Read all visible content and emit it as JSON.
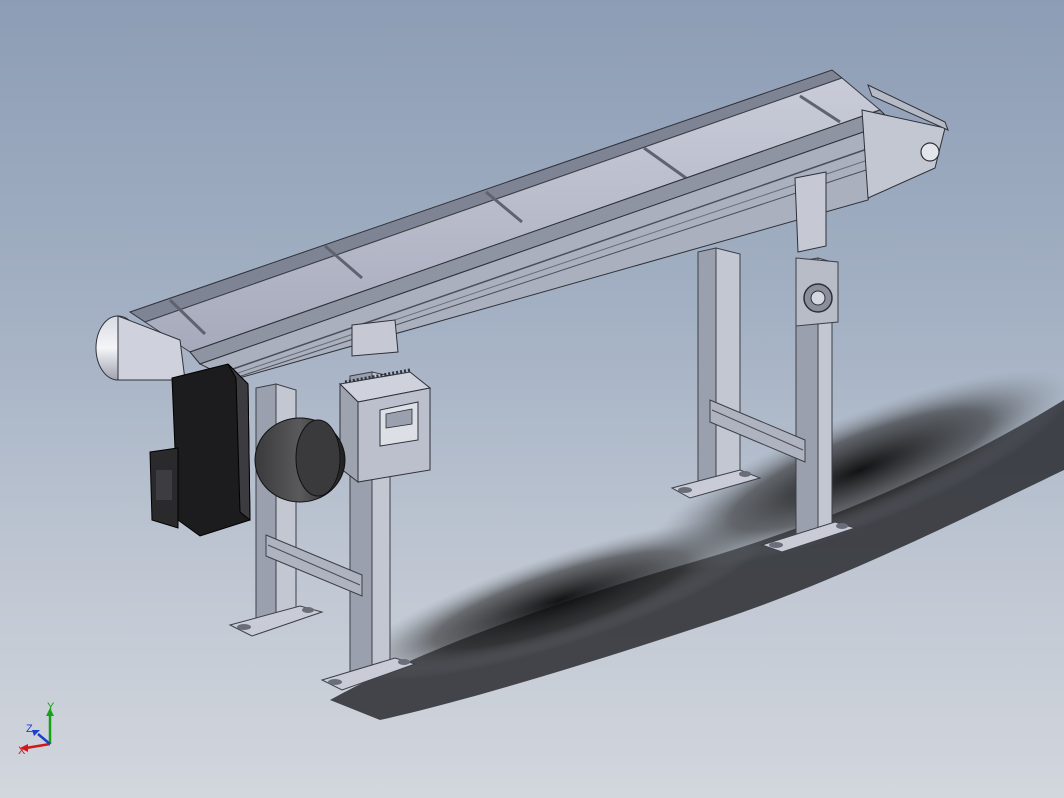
{
  "viewport": {
    "background_top": "#8d9db5",
    "background_bottom": "#d2d6dd"
  },
  "model": {
    "name": "belt-conveyor-assembly",
    "frame_color": "#a9aebb",
    "belt_color": "#b3b6c8",
    "motor_color": "#2f2f31",
    "drive_cover_color": "#1c1c1e",
    "controller_color": "#bcc0cc"
  },
  "triad": {
    "x_label": "X",
    "y_label": "Y",
    "z_label": "Z",
    "x_color": "#d01818",
    "y_color": "#18a018",
    "z_color": "#1a3fd0"
  }
}
